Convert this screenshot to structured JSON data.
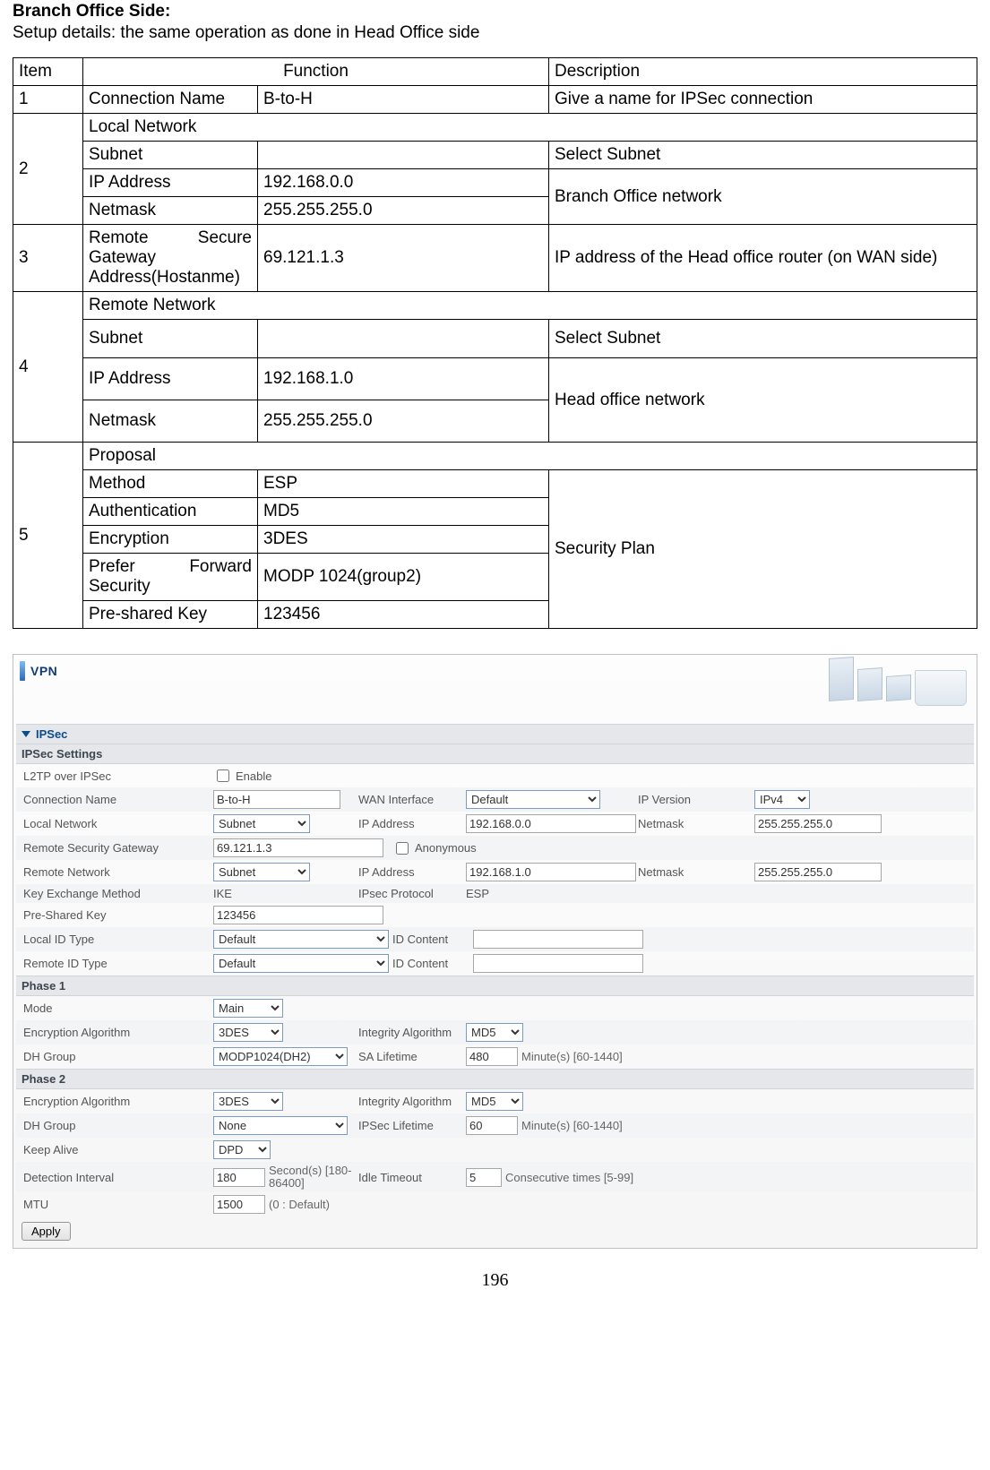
{
  "heading": "Branch Office Side:",
  "intro": "Setup details: the same operation as done in Head Office side",
  "info_table": {
    "headers": {
      "item": "Item",
      "function": "Function",
      "description": "Description"
    },
    "rows": {
      "1": {
        "item": "1",
        "f1": "Connection Name",
        "f2": "B-to-H",
        "desc": "Give a name for IPSec connection"
      },
      "2h": {
        "item": "2",
        "label": "Local Network"
      },
      "2a": {
        "f1": "Subnet",
        "f2": "",
        "desc": "Select Subnet"
      },
      "2b": {
        "f1": "IP Address",
        "f2": "192.168.0.0",
        "desc": "Branch Office network"
      },
      "2c": {
        "f1": "Netmask",
        "f2": "255.255.255.0"
      },
      "3": {
        "item": "3",
        "f1": "Remote Secure Gateway Address(Hostanme)",
        "f2": "69.121.1.3",
        "desc": "IP address of the Head office router (on WAN side)"
      },
      "4h": {
        "item": "4",
        "label": "Remote Network"
      },
      "4a": {
        "f1": "Subnet",
        "f2": "",
        "desc": "Select Subnet"
      },
      "4b": {
        "f1": "IP Address",
        "f2": "192.168.1.0",
        "desc": "Head office network"
      },
      "4c": {
        "f1": "Netmask",
        "f2": "255.255.255.0"
      },
      "5h": {
        "item": "5",
        "label": "Proposal"
      },
      "5a": {
        "f1": "Method",
        "f2": "ESP",
        "desc": "Security Plan"
      },
      "5b": {
        "f1": "Authentication",
        "f2": "MD5"
      },
      "5c": {
        "f1": "Encryption",
        "f2": "3DES"
      },
      "5d": {
        "f1": "Prefer Forward Security",
        "f2": "MODP 1024(group2)"
      },
      "5e": {
        "f1": "Pre-shared Key",
        "f2": "123456"
      }
    }
  },
  "vpn": {
    "title": "VPN",
    "ipsec_hdr": "IPSec",
    "settings_hdr": "IPSec Settings",
    "phase1_hdr": "Phase 1",
    "phase2_hdr": "Phase 2",
    "labels": {
      "l2tp": "L2TP over IPSec",
      "enable": "Enable",
      "conn_name": "Connection Name",
      "wan_if": "WAN Interface",
      "ip_ver": "IP Version",
      "local_net": "Local Network",
      "ip_addr": "IP Address",
      "netmask": "Netmask",
      "rsg": "Remote Security Gateway",
      "anon": "Anonymous",
      "remote_net": "Remote Network",
      "kem": "Key Exchange Method",
      "ipsec_proto": "IPsec Protocol",
      "psk": "Pre-Shared Key",
      "local_id": "Local ID Type",
      "remote_id": "Remote ID Type",
      "id_content": "ID Content",
      "mode": "Mode",
      "enc_algo": "Encryption Algorithm",
      "int_algo": "Integrity Algorithm",
      "dh_group": "DH Group",
      "sa_life": "SA Lifetime",
      "ipsec_life": "IPSec Lifetime",
      "keep_alive": "Keep Alive",
      "det_int": "Detection Interval",
      "idle_to": "Idle Timeout",
      "mtu": "MTU",
      "apply": "Apply"
    },
    "hints": {
      "min1": "Minute(s) [60-1440]",
      "min2": "Minute(s) [60-1440]",
      "sec": "Second(s) [180-86400]",
      "cons": "Consecutive times [5-99]",
      "mtu0": "(0 : Default)"
    },
    "values": {
      "conn_name": "B-to-H",
      "wan_if": "Default",
      "ip_ver": "IPv4",
      "local_net_type": "Subnet",
      "local_ip": "192.168.0.0",
      "local_mask": "255.255.255.0",
      "rsg": "69.121.1.3",
      "remote_net_type": "Subnet",
      "remote_ip": "192.168.1.0",
      "remote_mask": "255.255.255.0",
      "kem": "IKE",
      "ipsec_proto": "ESP",
      "psk": "123456",
      "local_id": "Default",
      "local_id_content": "",
      "remote_id": "Default",
      "remote_id_content": "",
      "p1_mode": "Main",
      "p1_enc": "3DES",
      "p1_int": "MD5",
      "p1_dh": "MODP1024(DH2)",
      "p1_sa": "480",
      "p2_enc": "3DES",
      "p2_int": "MD5",
      "p2_dh": "None",
      "p2_life": "60",
      "keep_alive": "DPD",
      "det_int": "180",
      "idle_to": "5",
      "mtu": "1500"
    }
  },
  "page_number": "196"
}
